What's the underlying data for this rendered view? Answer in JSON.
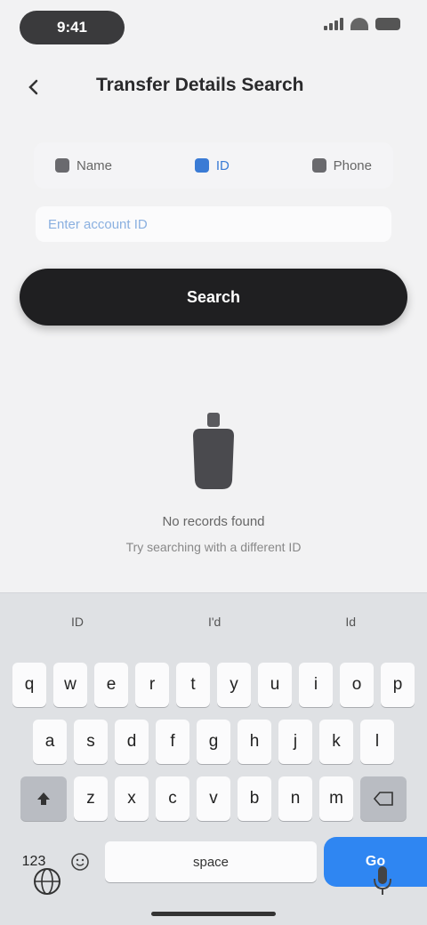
{
  "status_bar": {
    "time": "9:41"
  },
  "header": {
    "title": "Transfer Details Search"
  },
  "tabs": [
    {
      "label": "Name",
      "active": false
    },
    {
      "label": "ID",
      "active": true
    },
    {
      "label": "Phone",
      "active": false
    }
  ],
  "search": {
    "value": "",
    "placeholder": "Enter account ID"
  },
  "primary_button": {
    "label": "Search"
  },
  "empty_state": {
    "icon": "document-icon",
    "title": "No records found",
    "subtitle": "Try searching with a different ID"
  },
  "keyboard": {
    "suggestions": [
      "ID",
      "I'd",
      "Id"
    ],
    "row1": [
      "q",
      "w",
      "e",
      "r",
      "t",
      "y",
      "u",
      "i",
      "o",
      "p"
    ],
    "row2": [
      "a",
      "s",
      "d",
      "f",
      "g",
      "h",
      "j",
      "k",
      "l"
    ],
    "row3": [
      "z",
      "x",
      "c",
      "v",
      "b",
      "n",
      "m"
    ],
    "mode_label": "123",
    "space_label": "space",
    "go_label": "Go"
  },
  "colors": {
    "accent": "#2f86f2",
    "button_dark": "#1f1f21",
    "tab_active": "#3a7bd5"
  }
}
